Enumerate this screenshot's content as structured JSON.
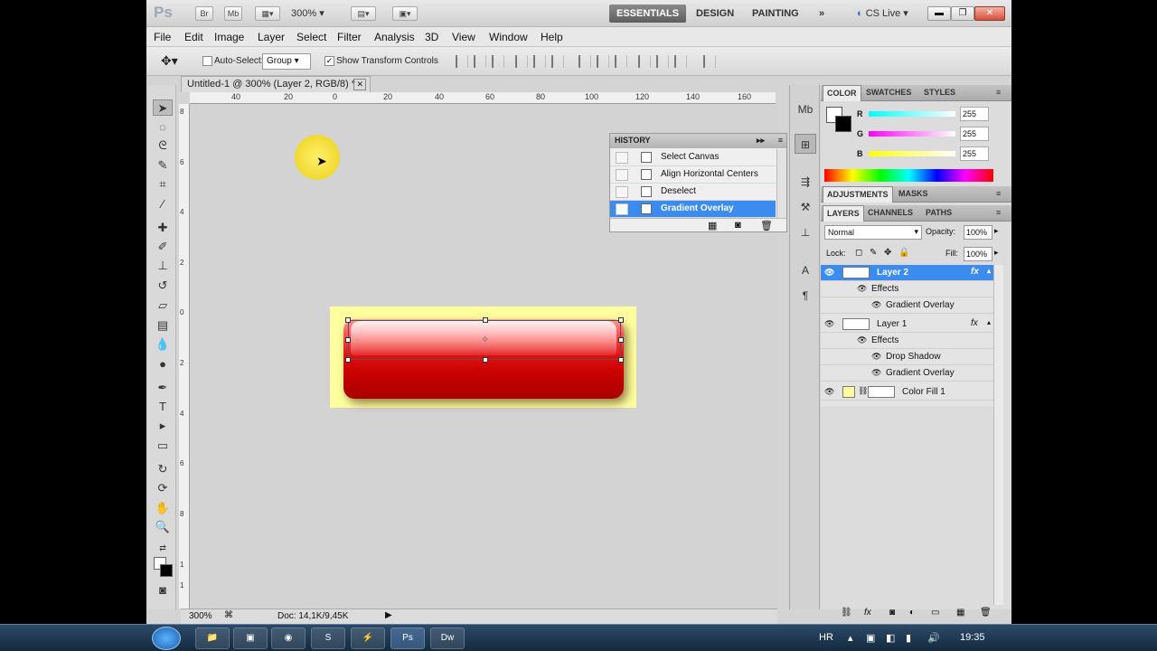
{
  "app": {
    "logo": "Ps",
    "bridge_btn": "Br",
    "minibridge_btn": "Mb",
    "zoom": "300%",
    "workspaces": [
      "ESSENTIALS",
      "DESIGN",
      "PAINTING",
      "»"
    ],
    "cs_live": "CS Live"
  },
  "menu": [
    "File",
    "Edit",
    "Image",
    "Layer",
    "Select",
    "Filter",
    "Analysis",
    "3D",
    "View",
    "Window",
    "Help"
  ],
  "options": {
    "auto_select_label": "Auto-Select:",
    "auto_select_value": "Group",
    "show_transform_label": "Show Transform Controls",
    "show_transform_checked": "✓"
  },
  "document": {
    "tab_title": "Untitled-1 @ 300% (Layer 2, RGB/8) *",
    "ruler_h": [
      "40",
      "20",
      "0",
      "20",
      "40",
      "60",
      "80",
      "100",
      "120",
      "140",
      "160"
    ],
    "ruler_v": [
      "8",
      "6",
      "4",
      "2",
      "0",
      "2",
      "4",
      "6",
      "8",
      "1",
      "1"
    ],
    "status_zoom": "300%",
    "status_doc": "Doc: 14,1K/9,45K"
  },
  "history": {
    "title": "HISTORY",
    "items": [
      "Select Canvas",
      "Align Horizontal Centers",
      "Deselect",
      "Gradient Overlay"
    ]
  },
  "color_panel": {
    "tabs": [
      "COLOR",
      "SWATCHES",
      "STYLES"
    ],
    "channels": [
      {
        "label": "R",
        "value": "255"
      },
      {
        "label": "G",
        "value": "255"
      },
      {
        "label": "B",
        "value": "255"
      }
    ]
  },
  "adjust_panel": {
    "tabs": [
      "ADJUSTMENTS",
      "MASKS"
    ]
  },
  "layers_panel": {
    "tabs": [
      "LAYERS",
      "CHANNELS",
      "PATHS"
    ],
    "blend_mode": "Normal",
    "opacity_label": "Opacity:",
    "opacity": "100%",
    "lock_label": "Lock:",
    "fill_label": "Fill:",
    "fill": "100%",
    "rows": [
      {
        "name": "Layer 2",
        "kind": "layer"
      },
      {
        "name": "Effects",
        "kind": "effects"
      },
      {
        "name": "Gradient Overlay",
        "kind": "effect"
      },
      {
        "name": "Layer 1",
        "kind": "layer"
      },
      {
        "name": "Effects",
        "kind": "effects"
      },
      {
        "name": "Drop Shadow",
        "kind": "effect"
      },
      {
        "name": "Gradient Overlay",
        "kind": "effect"
      },
      {
        "name": "Color Fill 1",
        "kind": "fill"
      }
    ]
  },
  "taskbar": {
    "lang": "HR",
    "clock": "19:35"
  },
  "colors": {
    "selection_blue": "#3c8cf0",
    "button_red": "#c70000",
    "fill_yellow": "#ffff9e"
  }
}
